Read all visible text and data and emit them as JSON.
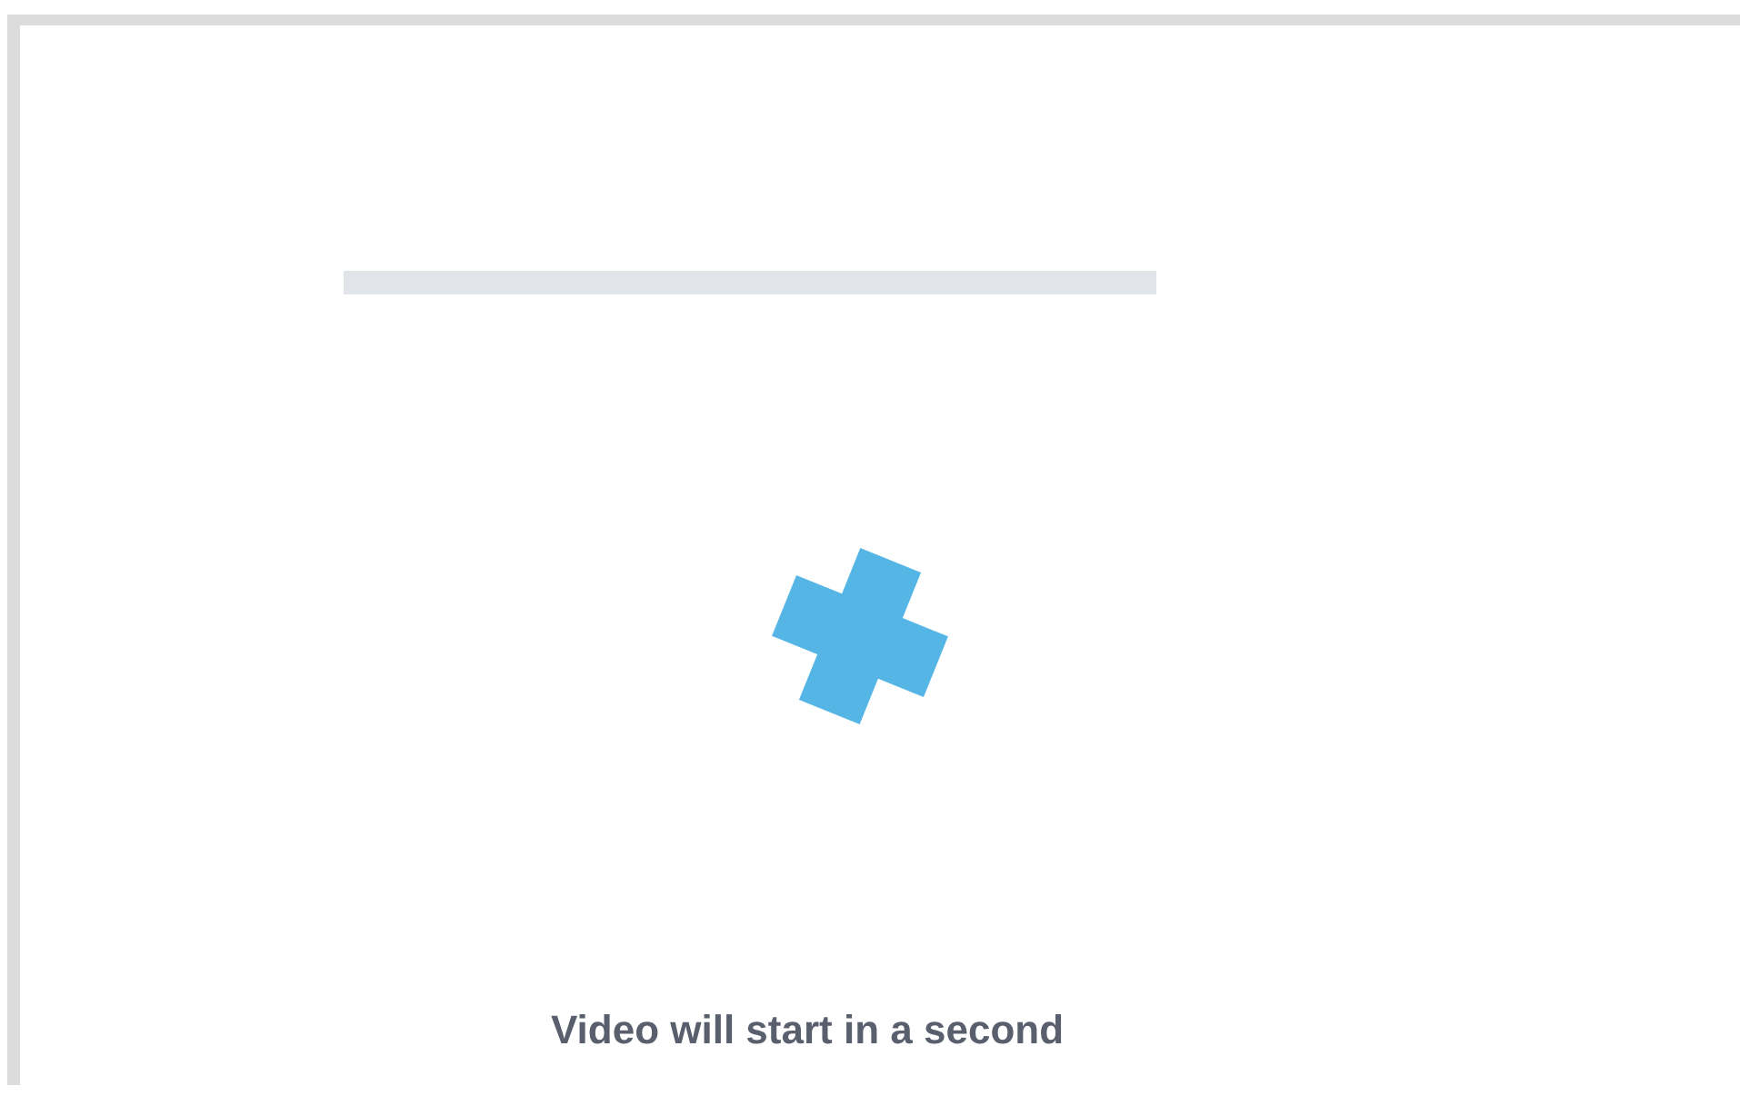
{
  "message": {
    "text": "Video will start in a second"
  }
}
